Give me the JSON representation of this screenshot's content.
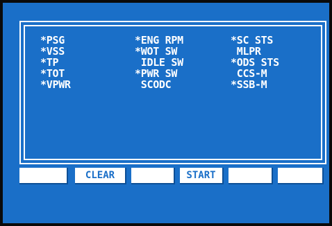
{
  "menu": {
    "columns": [
      {
        "items": [
          "*PSG",
          "*VSS",
          "*TP",
          "*TOT",
          "*VPWR"
        ]
      },
      {
        "items": [
          "*ENG RPM",
          "*WOT SW",
          " IDLE SW",
          "*PWR SW",
          " SCODC"
        ]
      },
      {
        "items": [
          "*SC STS",
          " MLPR",
          "*ODS STS",
          " CCS-M",
          "*SSB-M"
        ]
      }
    ]
  },
  "softkeys": [
    "",
    "CLEAR",
    "",
    "START",
    "",
    ""
  ],
  "colors": {
    "background": "#1a6fc8",
    "foreground": "#ffffff",
    "frame": "#0a0a0a"
  }
}
